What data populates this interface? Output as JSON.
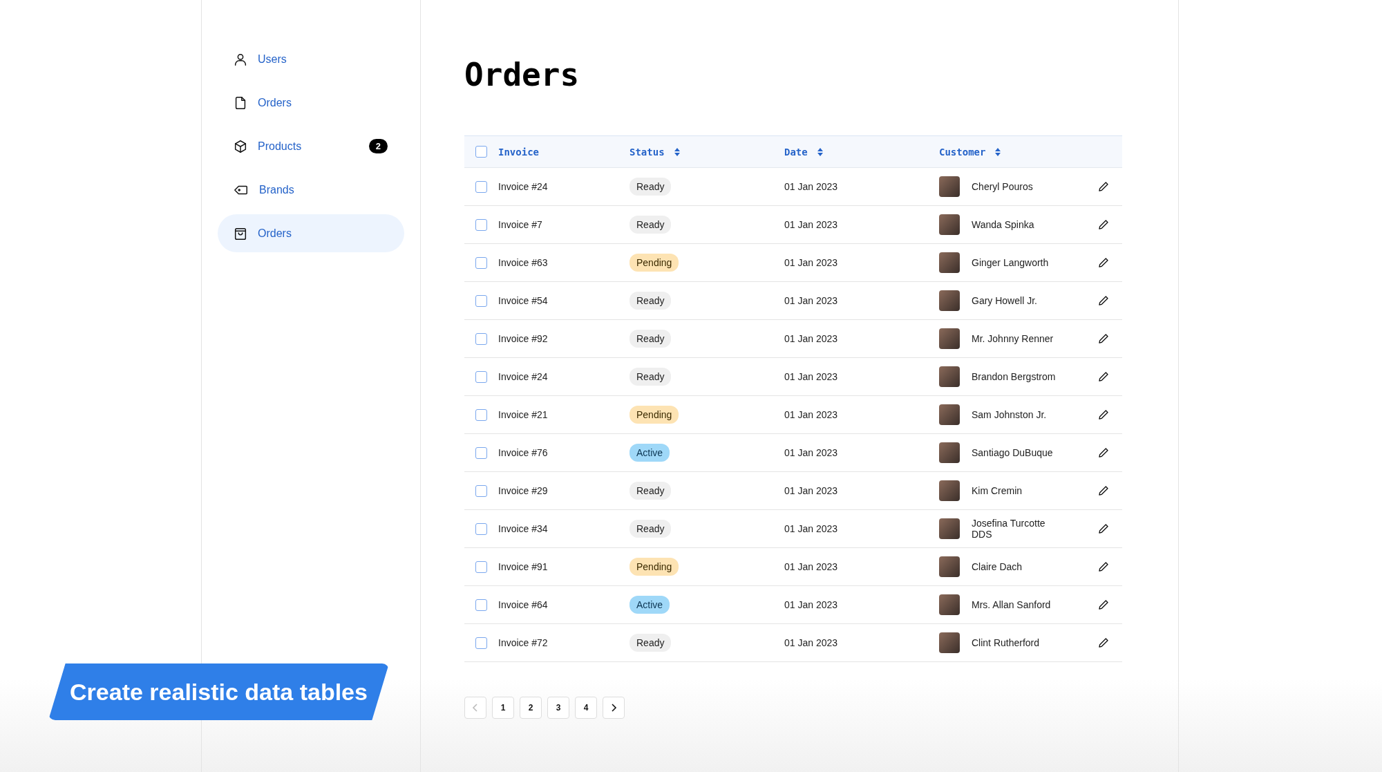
{
  "sidebar": {
    "items": [
      {
        "label": "Users",
        "selected": false
      },
      {
        "label": "Orders",
        "selected": false
      },
      {
        "label": "Products",
        "badge": "2",
        "selected": false
      },
      {
        "label": "Brands",
        "selected": false
      },
      {
        "label": "Orders",
        "selected": true
      }
    ]
  },
  "page_title": "Orders",
  "table": {
    "select_all": {
      "checked": false
    },
    "columns": [
      {
        "label": "Invoice",
        "sortable": false
      },
      {
        "label": "Status",
        "sortable": true
      },
      {
        "label": "Date",
        "sortable": true
      },
      {
        "label": "Customer",
        "sortable": true
      }
    ],
    "rows": [
      {
        "checked": false,
        "invoice": "Invoice #24",
        "status": {
          "label": "Ready",
          "kind": "ready"
        },
        "date": "01 Jan 2023",
        "customer": "Cheryl Pouros"
      },
      {
        "checked": false,
        "invoice": "Invoice #7",
        "status": {
          "label": "Ready",
          "kind": "ready"
        },
        "date": "01 Jan 2023",
        "customer": "Wanda Spinka"
      },
      {
        "checked": false,
        "invoice": "Invoice #63",
        "status": {
          "label": "Pending",
          "kind": "pending"
        },
        "date": "01 Jan 2023",
        "customer": "Ginger Langworth"
      },
      {
        "checked": false,
        "invoice": "Invoice #54",
        "status": {
          "label": "Ready",
          "kind": "ready"
        },
        "date": "01 Jan 2023",
        "customer": "Gary Howell Jr."
      },
      {
        "checked": false,
        "invoice": "Invoice #92",
        "status": {
          "label": "Ready",
          "kind": "ready"
        },
        "date": "01 Jan 2023",
        "customer": "Mr. Johnny Renner"
      },
      {
        "checked": false,
        "invoice": "Invoice #24",
        "status": {
          "label": "Ready",
          "kind": "ready"
        },
        "date": "01 Jan 2023",
        "customer": "Brandon Bergstrom"
      },
      {
        "checked": false,
        "invoice": "Invoice #21",
        "status": {
          "label": "Pending",
          "kind": "pending"
        },
        "date": "01 Jan 2023",
        "customer": "Sam Johnston Jr."
      },
      {
        "checked": false,
        "invoice": "Invoice #76",
        "status": {
          "label": "Active",
          "kind": "active"
        },
        "date": "01 Jan 2023",
        "customer": "Santiago DuBuque"
      },
      {
        "checked": false,
        "invoice": "Invoice #29",
        "status": {
          "label": "Ready",
          "kind": "ready"
        },
        "date": "01 Jan 2023",
        "customer": "Kim Cremin"
      },
      {
        "checked": false,
        "invoice": "Invoice #34",
        "status": {
          "label": "Ready",
          "kind": "ready"
        },
        "date": "01 Jan 2023",
        "customer": "Josefina Turcotte DDS"
      },
      {
        "checked": false,
        "invoice": "Invoice #91",
        "status": {
          "label": "Pending",
          "kind": "pending"
        },
        "date": "01 Jan 2023",
        "customer": "Claire Dach"
      },
      {
        "checked": false,
        "invoice": "Invoice #64",
        "status": {
          "label": "Active",
          "kind": "active"
        },
        "date": "01 Jan 2023",
        "customer": "Mrs. Allan Sanford"
      },
      {
        "checked": false,
        "invoice": "Invoice #72",
        "status": {
          "label": "Ready",
          "kind": "ready"
        },
        "date": "01 Jan 2023",
        "customer": "Clint Rutherford"
      }
    ]
  },
  "pagination": {
    "previous": {
      "disabled": true
    },
    "pages": [
      "1",
      "2",
      "3",
      "4"
    ],
    "next": {
      "disabled": false
    }
  },
  "banner": "Create realistic data tables"
}
